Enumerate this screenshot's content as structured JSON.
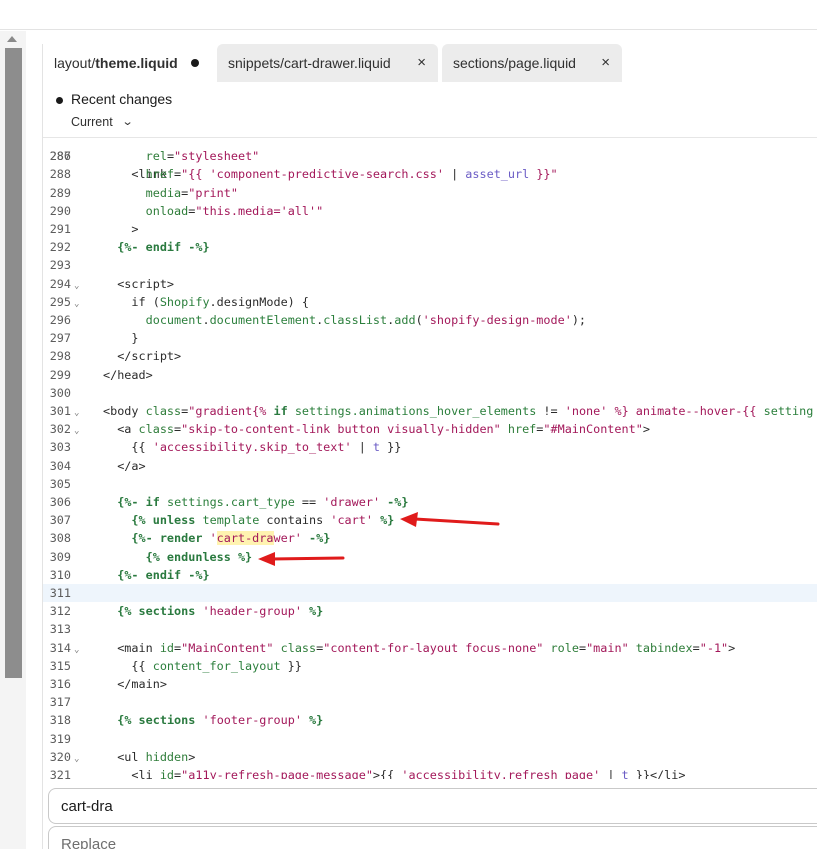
{
  "tabs": [
    {
      "prefix": "layout/",
      "name": "theme.liquid",
      "status": "modified"
    },
    {
      "label": "snippets/cart-drawer.liquid",
      "close": "×"
    },
    {
      "label": "sections/page.liquid",
      "close": "×"
    }
  ],
  "changes": {
    "title": "Recent changes",
    "version": "Current",
    "chevron": "⌄"
  },
  "code": {
    "top_partial": "    <link",
    "lines": [
      {
        "n": "287",
        "html": "      <span class=\"at\">rel</span>=<span class=\"str\">\"stylesheet\"</span>"
      },
      {
        "n": "288",
        "html": "      <span class=\"at\">href</span>=<span class=\"str\">\"{{ </span><span class=\"str\">'component-predictive-search.css'</span> | <span class=\"fl\">asset_url</span> <span class=\"str\">}}\"</span>"
      },
      {
        "n": "289",
        "html": "      <span class=\"at\">media</span>=<span class=\"str\">\"print\"</span>"
      },
      {
        "n": "290",
        "html": "      <span class=\"at\">onload</span>=<span class=\"str\">\"this.media='all'\"</span>"
      },
      {
        "n": "291",
        "html": "    >"
      },
      {
        "n": "292",
        "html": "  <span class=\"kw\">{%- endif -%}</span>"
      },
      {
        "n": "293",
        "html": ""
      },
      {
        "n": "294",
        "fold": true,
        "html": "  &lt;script&gt;"
      },
      {
        "n": "295",
        "fold": true,
        "html": "    if (<span class=\"tp\">Shopify</span>.designMode) {"
      },
      {
        "n": "296",
        "html": "      <span class=\"tp\">document</span>.<span class=\"tp\">documentElement</span>.<span class=\"tp\">classList</span>.<span class=\"tp\">add</span>(<span class=\"str\">'shopify-design-mode'</span>);"
      },
      {
        "n": "297",
        "html": "    }"
      },
      {
        "n": "298",
        "html": "  &lt;/script&gt;"
      },
      {
        "n": "299",
        "html": "&lt;/head&gt;"
      },
      {
        "n": "300",
        "html": ""
      },
      {
        "n": "301",
        "fold": true,
        "html": "&lt;body <span class=\"at\">class</span>=<span class=\"str\">\"gradient{%</span> <span class=\"kw\">if</span> <span class=\"tp\">settings.animations_hover_elements</span> != <span class=\"str\">'none'</span> <span class=\"str\">%} animate--hover-{{</span> <span class=\"tp\">setting</span>"
      },
      {
        "n": "302",
        "fold": true,
        "html": "  &lt;a <span class=\"at\">class</span>=<span class=\"str\">\"skip-to-content-link button visually-hidden\"</span> <span class=\"at\">href</span>=<span class=\"str\">\"#MainContent\"</span>&gt;"
      },
      {
        "n": "303",
        "html": "    {{ <span class=\"str\">'accessibility.skip_to_text'</span> | <span class=\"fl\">t</span> }}"
      },
      {
        "n": "304",
        "html": "  &lt;/a&gt;"
      },
      {
        "n": "305",
        "html": ""
      },
      {
        "n": "306",
        "html": "  <span class=\"kw\">{%-</span> <span class=\"kw\">if</span> <span class=\"tp\">settings.cart_type</span> == <span class=\"str\">'drawer'</span> <span class=\"kw\">-%}</span>"
      },
      {
        "n": "307",
        "html": "    <span class=\"kw\">{%</span> <span class=\"kw\">unless</span> <span class=\"tp\">template</span> contains <span class=\"str\">'cart'</span> <span class=\"kw\">%}</span>"
      },
      {
        "n": "308",
        "html": "    <span class=\"kw\">{%- render</span> <span class=\"str\">'<span class=\"match\">cart-dra</span>wer'</span> <span class=\"kw\">-%}</span>"
      },
      {
        "n": "309",
        "html": "      <span class=\"kw\">{% endunless %}</span>"
      },
      {
        "n": "310",
        "html": "  <span class=\"kw\">{%- endif -%}</span>"
      },
      {
        "n": "311",
        "hl": true,
        "html": ""
      },
      {
        "n": "312",
        "html": "  <span class=\"kw\">{%</span> <span class=\"kw\">sections</span> <span class=\"str\">'header-group'</span> <span class=\"kw\">%}</span>"
      },
      {
        "n": "313",
        "html": ""
      },
      {
        "n": "314",
        "fold": true,
        "html": "  &lt;main <span class=\"at\">id</span>=<span class=\"str\">\"MainContent\"</span> <span class=\"at\">class</span>=<span class=\"str\">\"content-for-layout focus-none\"</span> <span class=\"at\">role</span>=<span class=\"str\">\"main\"</span> <span class=\"at\">tabindex</span>=<span class=\"str\">\"-1\"</span>&gt;"
      },
      {
        "n": "315",
        "html": "    {{ <span class=\"tp\">content_for_layout</span> }}"
      },
      {
        "n": "316",
        "html": "  &lt;/main&gt;"
      },
      {
        "n": "317",
        "html": ""
      },
      {
        "n": "318",
        "html": "  <span class=\"kw\">{%</span> <span class=\"kw\">sections</span> <span class=\"str\">'footer-group'</span> <span class=\"kw\">%}</span>"
      },
      {
        "n": "319",
        "html": ""
      },
      {
        "n": "320",
        "fold": true,
        "html": "  &lt;ul <span class=\"at\">hidden</span>&gt;"
      },
      {
        "n": "321",
        "html": "    &lt;li <span class=\"at\">id</span>=<span class=\"str\">\"a11y-refresh-page-message\"</span>&gt;{{ <span class=\"str\">'accessibility.refresh_page'</span> | <span class=\"fl\">t</span> }}&lt;/li&gt;"
      }
    ]
  },
  "annotations": {
    "arrow_color": "#e01b1b"
  },
  "find": {
    "value": "cart-dra"
  },
  "replace": {
    "placeholder": "Replace"
  }
}
